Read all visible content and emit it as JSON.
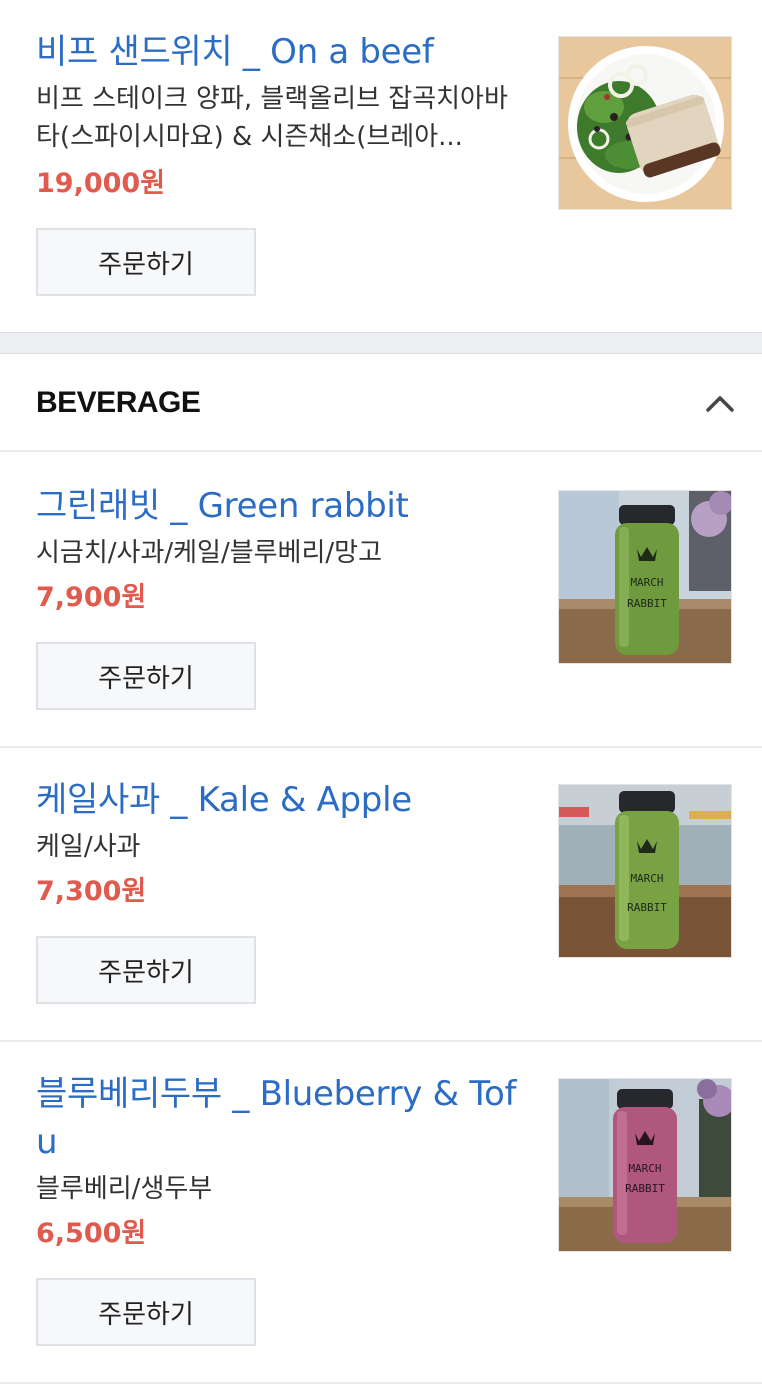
{
  "items": [
    {
      "title": "비프 샌드위치 _ On a beef",
      "desc": "비프 스테이크 양파, 블랙올리브 잡곡치아바타(스파이시마요) & 시즌채소(브레아...",
      "price": "19,000원",
      "button": "주문하기",
      "image": "beef-sandwich-plate"
    },
    {
      "title": "그린래빗 _ Green rabbit",
      "desc": "시금치/사과/케일/블루베리/망고",
      "price": "7,900원",
      "button": "주문하기",
      "image": "green-juice-bottle",
      "bottle_label": [
        "MARCH",
        "RABBIT"
      ]
    },
    {
      "title": "케일사과 _ Kale & Apple",
      "desc": "케일/사과",
      "price": "7,300원",
      "button": "주문하기",
      "image": "kale-apple-juice-bottle",
      "bottle_label": [
        "MARCH",
        "RABBIT"
      ]
    },
    {
      "title": "블루베리두부 _ Blueberry & Tofu",
      "desc": "블루베리/생두부",
      "price": "6,500원",
      "button": "주문하기",
      "image": "blueberry-tofu-juice-bottle",
      "bottle_label": [
        "MARCH",
        "RABBIT"
      ]
    }
  ],
  "section": {
    "title": "BEVERAGE",
    "toggle_icon": "chevron-up-icon"
  },
  "colors": {
    "title": "#2b6cc4",
    "price": "#e05a4e",
    "button_bg": "#f7f8fa",
    "band": "#eceef2"
  }
}
